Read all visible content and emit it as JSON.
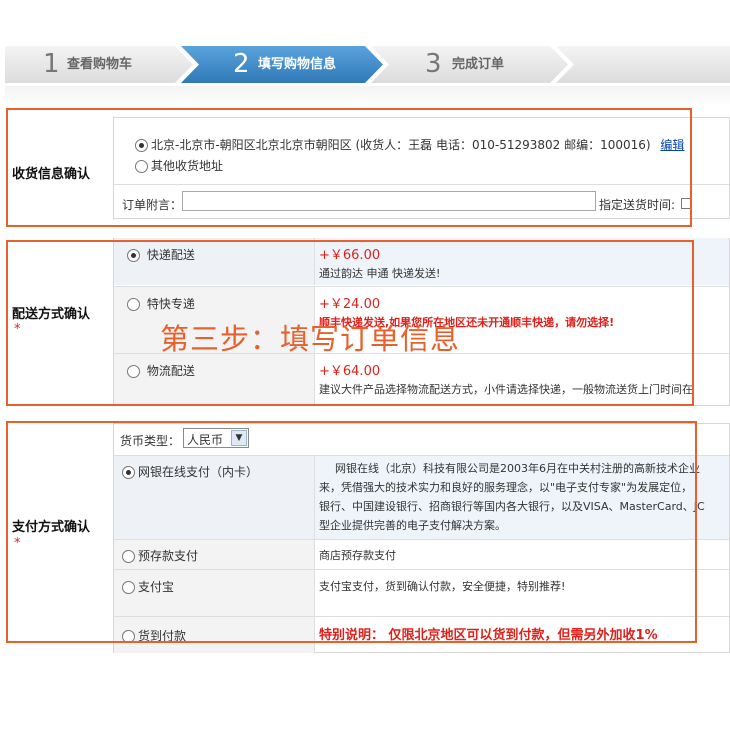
{
  "steps": [
    {
      "num": "1",
      "label": "查看购物车"
    },
    {
      "num": "2",
      "label": "填写购物信息"
    },
    {
      "num": "3",
      "label": "完成订单"
    }
  ],
  "shipping_info": {
    "title": "收货信息确认",
    "address": "北京-北京市-朝阳区北京北京市朝阳区 (收货人：王磊 电话：010-51293802 邮编：100016)",
    "edit": "编辑",
    "other": "其他收货地址",
    "note_label": "订单附言：",
    "note_value": "",
    "delivery_time_label": "指定送货时间:"
  },
  "delivery": {
    "title": "配送方式确认",
    "star": "*",
    "options": [
      {
        "name": "快递配送",
        "price": "+￥66.00",
        "desc": "通过韵达 申通 快递发送!"
      },
      {
        "name": "特快专递",
        "price": "+￥24.00",
        "desc": "顺丰快递发送,如果您所在地区还未开通顺丰快递，请勿选择!"
      },
      {
        "name": "物流配送",
        "price": "+￥64.00",
        "desc": "建议大件产品选择物流配送方式，小件请选择快递，一般物流送货上门时间在"
      }
    ]
  },
  "overlay_text": "第三步：填写订单信息",
  "payment": {
    "title": "支付方式确认",
    "star": "*",
    "currency_label": "货币类型：",
    "currency_value": "人民币",
    "options": [
      {
        "name": "网银在线支付（内卡）",
        "desc": [
          "网银在线（北京）科技有限公司是2003年6月在中关村注册的高新技术企业",
          "来，凭借强大的技术实力和良好的服务理念，以\"电子支付专家\"为发展定位，",
          "银行、中国建设银行、招商银行等国内各大银行，以及VISA、MasterCard、JC",
          "型企业提供完善的电子支付解决方案。"
        ]
      },
      {
        "name": "预存款支付",
        "desc": [
          "商店预存款支付"
        ]
      },
      {
        "name": "支付宝",
        "desc": [
          "支付宝支付，货到确认付款，安全便捷，特别推荐!"
        ]
      },
      {
        "name": "货到付款",
        "desc": [
          "特别说明： 仅限北京地区可以货到付款，但需另外加收1%"
        ]
      }
    ]
  },
  "colors": {
    "accent_blue": "#3b86c6",
    "highlight_border": "#e8602c",
    "price_red": "#e0201a"
  }
}
